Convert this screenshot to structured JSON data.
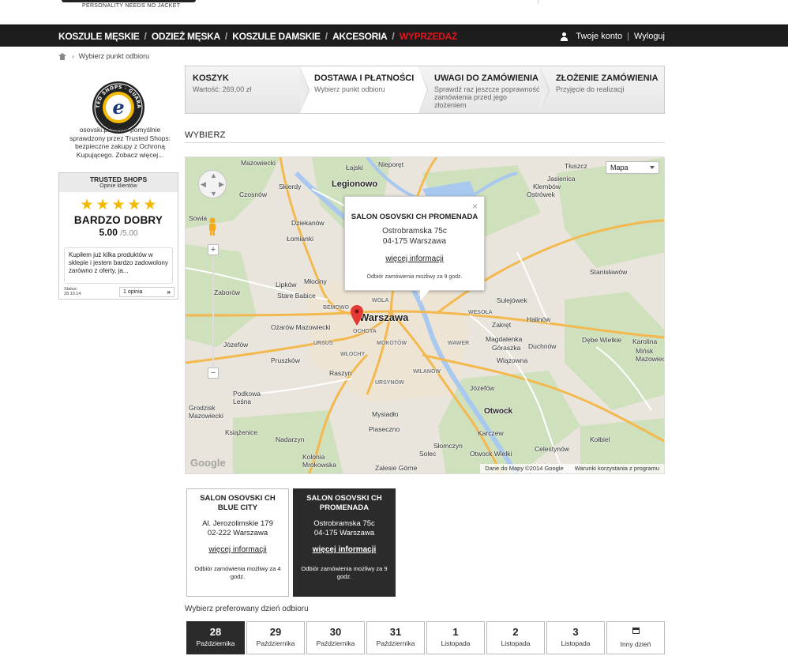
{
  "header": {
    "tagline": "PERSONALITY NEEDS NO JACKET"
  },
  "nav": {
    "items": [
      {
        "label": "KOSZULE MĘSKIE"
      },
      {
        "label": "ODZIEŻ MĘSKA"
      },
      {
        "label": "KOSZULE DAMSKIE"
      },
      {
        "label": "AKCESORIA"
      },
      {
        "label": "WYPRZEDAŻ"
      }
    ],
    "separator": "/",
    "account": "Twoje konto",
    "account_sep": "|",
    "logout": "Wyloguj"
  },
  "breadcrumb": {
    "arrow": "›",
    "current": "Wybierz punkt odbioru"
  },
  "sidebar": {
    "badge_text": "TRUSTED SHOPS · GUARANTEE",
    "badge_letter": "e",
    "trust_text": "osovski.pl został pomyślnie sprawdzony przez Trusted Shops: bezpieczne zakupy z Ochroną Kupującego. Zobacz więcej...",
    "widget": {
      "title": "TRUSTED SHOPS",
      "subtitle": "Opinie klientów",
      "stars": "★★★★★",
      "rating_word": "BARDZO DOBRY",
      "score": "5.00",
      "score_max": "/5.00",
      "review": "Kupiłem już kilka produktów w sklepie i jestem bardzo zadowolony zarówno z oferty, ja...",
      "status_label": "Status:",
      "status_date": "28.10.14",
      "count": "1 opinia",
      "count_arrows": "»"
    }
  },
  "steps": [
    {
      "title": "KOSZYK",
      "sub": "Wartość: 269,00 zł"
    },
    {
      "title": "DOSTAWA I PŁATNOŚCI",
      "sub": "Wybierz punkt odbioru"
    },
    {
      "title": "UWAGI DO ZAMÓWIENIA",
      "sub": "Sprawdź raz jeszcze poprawność zamówienia przed jego złożeniem"
    },
    {
      "title": "ZŁOŻENIE ZAMÓWIENIA",
      "sub": "Przyjęcie do realizacji"
    }
  ],
  "section_title": "WYBIERZ",
  "map": {
    "type_select": "Mapa",
    "zoom_in": "+",
    "zoom_out": "−",
    "labels": {
      "mazowiecki_top": "Mazowiecki",
      "laski": "Łajski",
      "nieporet": "Nieporęt",
      "tluszcz": "Tłuszcz",
      "skierdy": "Skierdy",
      "legionowo": "Legionowo",
      "jasienica": "Jasienica",
      "klembow": "Klembów",
      "czosnow": "Czosnów",
      "dziekanow": "Dziekanów",
      "lomianki": "Łomianki",
      "stryjkowe": "Ostrówek",
      "sowia": "Sowia",
      "stanislawow": "Stanisławów",
      "lipkow": "Lipków",
      "mlociny": "Młociny",
      "stare_babice": "Stare Babice",
      "sulejowek": "Sulejówek",
      "zaborow": "Zaborów",
      "bemowo": "BEMOWO",
      "warszawa": "Warszawa",
      "wesola": "WESOŁA",
      "halinow": "Halinów",
      "ozarow": "Ożarów Mazowiecki",
      "ochota": "OCHOTA",
      "zakret": "Zakręt",
      "wola": "WOLA",
      "mokotow": "MOKOTÓW",
      "wawer": "WAWER",
      "magdalenka": "Magdalenka",
      "ursus": "URSUS",
      "wlochy": "WŁOCHY",
      "goraszka": "Góraszka",
      "duchnow": "Duchnów",
      "debe": "Dębe Wielkie",
      "karolina": "Karolina",
      "minsk": "Mińsk Mazowiecki",
      "jozefow_left": "Józefów",
      "pruszkow": "Pruszków",
      "raszyn": "Raszyn",
      "ursynow": "URSYNÓW",
      "wilanow": "WILANÓW",
      "wiazowna": "Wiązowna",
      "jozefow": "Józefów",
      "pilawa": "Piaseczno",
      "podkowa": "Podkowa Leśna",
      "grodzisk": "Grodzisk Mazowiecki",
      "otwock": "Otwock",
      "karczew": "Karczew",
      "kobiel": "Kołbiel",
      "slomczyn": "Słomczyn",
      "otwock_w": "Otwock Wielki",
      "celestynow": "Celestynów",
      "sosnowe": "Kolonia Mrokowska",
      "zalesie": "Zalesie Górne",
      "solec": "Solec",
      "ksiazenice": "Książenice",
      "mysiadlo": "Mysiadło",
      "nadarzyn": "Nadarzyn"
    },
    "infowindow": {
      "name": "SALON OSOVSKI CH PROMENADA",
      "street": "Ostrobramska 75c",
      "city": "04-175 Warszawa",
      "more": "więcej informacji",
      "note": "Odbiór zamówienia możliwy za 9 godz.",
      "close": "×"
    },
    "footer_data": "Dane do Mapy ©2014 Google",
    "footer_terms": "Warunki korzystania z programu",
    "google": "Google"
  },
  "stores": [
    {
      "name": "SALON OSOVSKI CH BLUE CITY",
      "street": "Al. Jerozolimskie 179",
      "city": "02-222 Warszawa",
      "more": "więcej informacji",
      "note": "Odbiór zamówienia możliwy za 4 godz."
    },
    {
      "name": "SALON OSOVSKI CH PROMENADA",
      "street": "Ostrobramska 75c",
      "city": "04-175 Warszawa",
      "more": "więcej informacji",
      "note": "Odbiór zamówienia możliwy za 9 godz."
    }
  ],
  "pref_label": "Wybierz preferowany dzień odbioru",
  "days": [
    {
      "n": "28",
      "m": "Października"
    },
    {
      "n": "29",
      "m": "Października"
    },
    {
      "n": "30",
      "m": "Października"
    },
    {
      "n": "31",
      "m": "Października"
    },
    {
      "n": "1",
      "m": "Listopada"
    },
    {
      "n": "2",
      "m": "Listopada"
    },
    {
      "n": "3",
      "m": "Listopada"
    }
  ],
  "other_day": "Inny dzień",
  "colors": {
    "accent_sale": "#e0141e",
    "dark": "#2b2b2b",
    "star": "#f3b800"
  }
}
